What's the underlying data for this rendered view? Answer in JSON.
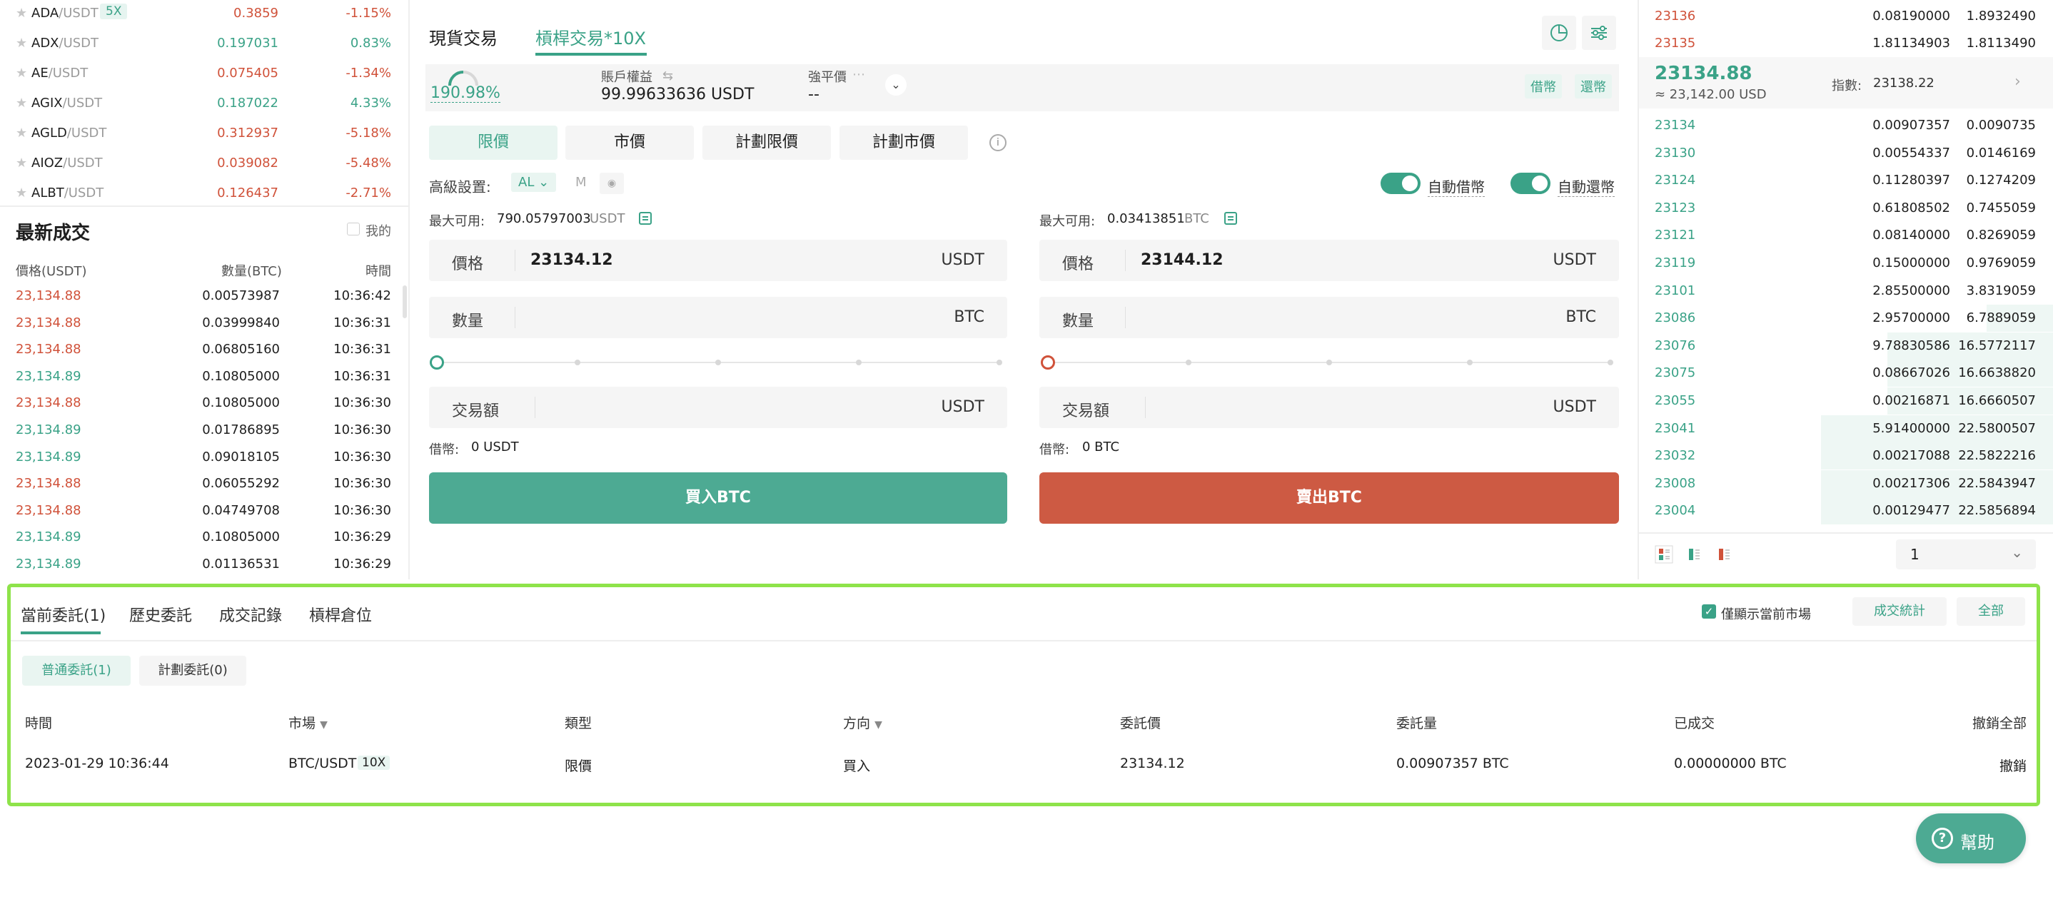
{
  "markets": [
    {
      "base": "ADA",
      "quote": "/USDT",
      "lev": "5X",
      "price": "0.3859",
      "change": "-1.15%",
      "dir": "down"
    },
    {
      "base": "ADX",
      "quote": "/USDT",
      "lev": "",
      "price": "0.197031",
      "change": "0.83%",
      "dir": "up"
    },
    {
      "base": "AE",
      "quote": "/USDT",
      "lev": "",
      "price": "0.075405",
      "change": "-1.34%",
      "dir": "down"
    },
    {
      "base": "AGIX",
      "quote": "/USDT",
      "lev": "",
      "price": "0.187022",
      "change": "4.33%",
      "dir": "up"
    },
    {
      "base": "AGLD",
      "quote": "/USDT",
      "lev": "",
      "price": "0.312937",
      "change": "-5.18%",
      "dir": "down"
    },
    {
      "base": "AIOZ",
      "quote": "/USDT",
      "lev": "",
      "price": "0.039082",
      "change": "-5.48%",
      "dir": "down"
    },
    {
      "base": "ALBT",
      "quote": "/USDT",
      "lev": "",
      "price": "0.126437",
      "change": "-2.71%",
      "dir": "down"
    }
  ],
  "latest_trades": {
    "title": "最新成交",
    "mine_label": "我的",
    "headers": {
      "price": "價格(USDT)",
      "qty": "數量(BTC)",
      "time": "時間"
    },
    "rows": [
      {
        "price": "23,134.88",
        "qty": "0.00573987",
        "time": "10:36:42",
        "dir": "down"
      },
      {
        "price": "23,134.88",
        "qty": "0.03999840",
        "time": "10:36:31",
        "dir": "down"
      },
      {
        "price": "23,134.88",
        "qty": "0.06805160",
        "time": "10:36:31",
        "dir": "down"
      },
      {
        "price": "23,134.89",
        "qty": "0.10805000",
        "time": "10:36:31",
        "dir": "up"
      },
      {
        "price": "23,134.88",
        "qty": "0.10805000",
        "time": "10:36:30",
        "dir": "down"
      },
      {
        "price": "23,134.89",
        "qty": "0.01786895",
        "time": "10:36:30",
        "dir": "up"
      },
      {
        "price": "23,134.89",
        "qty": "0.09018105",
        "time": "10:36:30",
        "dir": "up"
      },
      {
        "price": "23,134.88",
        "qty": "0.06055292",
        "time": "10:36:30",
        "dir": "down"
      },
      {
        "price": "23,134.88",
        "qty": "0.04749708",
        "time": "10:36:30",
        "dir": "down"
      },
      {
        "price": "23,134.89",
        "qty": "0.10805000",
        "time": "10:36:29",
        "dir": "up"
      },
      {
        "price": "23,134.89",
        "qty": "0.01136531",
        "time": "10:36:29",
        "dir": "up"
      }
    ]
  },
  "trade_tabs": {
    "spot": "現貨交易",
    "margin": "槓桿交易*10X"
  },
  "account": {
    "risk": "190.98%",
    "equity_label": "賬戶權益",
    "equity_value": "99.99633636 USDT",
    "liq_label": "強平價",
    "liq_value": "--",
    "borrow_btn": "借幣",
    "repay_btn": "還幣"
  },
  "order_types": [
    "限價",
    "市價",
    "計劃限價",
    "計劃市價"
  ],
  "advanced": {
    "label": "高級設置:",
    "al": "AL",
    "m": "M",
    "auto_borrow": "自動借幣",
    "auto_repay": "自動還幣"
  },
  "buy": {
    "avail_label": "最大可用:",
    "avail_value": "790.05797003",
    "avail_unit": "USDT",
    "price_label": "價格",
    "price_value": "23134.12",
    "price_unit": "USDT",
    "qty_label": "數量",
    "qty_unit": "BTC",
    "amt_label": "交易額",
    "amt_unit": "USDT",
    "borrow_label": "借幣:",
    "borrow_value": "0 USDT",
    "button": "買入BTC"
  },
  "sell": {
    "avail_label": "最大可用:",
    "avail_value": "0.03413851",
    "avail_unit": "BTC",
    "price_label": "價格",
    "price_value": "23144.12",
    "price_unit": "USDT",
    "qty_label": "數量",
    "qty_unit": "BTC",
    "amt_label": "交易額",
    "amt_unit": "USDT",
    "borrow_label": "借幣:",
    "borrow_value": "0 BTC",
    "button": "賣出BTC"
  },
  "orderbook": {
    "asks": [
      {
        "price": "23136",
        "qty": "0.08190000",
        "sum": "1.8932490"
      },
      {
        "price": "23135",
        "qty": "1.81134903",
        "sum": "1.8113490"
      }
    ],
    "last_price": "23134.88",
    "last_usd": "≈ 23,142.00 USD",
    "index_label": "指數:",
    "index_value": "23138.22",
    "bids": [
      {
        "price": "23134",
        "qty": "0.00907357",
        "sum": "0.0090735",
        "depth": 0.0
      },
      {
        "price": "23130",
        "qty": "0.00554337",
        "sum": "0.0146169",
        "depth": 0.0
      },
      {
        "price": "23124",
        "qty": "0.11280397",
        "sum": "0.1274209",
        "depth": 0.0
      },
      {
        "price": "23123",
        "qty": "0.61808502",
        "sum": "0.7455059",
        "depth": 0.0
      },
      {
        "price": "23121",
        "qty": "0.08140000",
        "sum": "0.8269059",
        "depth": 0.0
      },
      {
        "price": "23119",
        "qty": "0.15000000",
        "sum": "0.9769059",
        "depth": 0.0
      },
      {
        "price": "23101",
        "qty": "2.85500000",
        "sum": "3.8319059",
        "depth": 0.0
      },
      {
        "price": "23086",
        "qty": "2.95700000",
        "sum": "6.7889059",
        "depth": 0.16
      },
      {
        "price": "23076",
        "qty": "9.78830586",
        "sum": "16.5772117",
        "depth": 0.4
      },
      {
        "price": "23075",
        "qty": "0.08667026",
        "sum": "16.6638820",
        "depth": 0.4
      },
      {
        "price": "23055",
        "qty": "0.00216871",
        "sum": "16.6660507",
        "depth": 0.4
      },
      {
        "price": "23041",
        "qty": "5.91400000",
        "sum": "22.5800507",
        "depth": 0.56
      },
      {
        "price": "23032",
        "qty": "0.00217088",
        "sum": "22.5822216",
        "depth": 0.56
      },
      {
        "price": "23008",
        "qty": "0.00217306",
        "sum": "22.5843947",
        "depth": 0.56
      },
      {
        "price": "23004",
        "qty": "0.00129477",
        "sum": "22.5856894",
        "depth": 0.56
      }
    ],
    "precision": "1"
  },
  "orders": {
    "tabs": [
      "當前委託(1)",
      "歷史委託",
      "成交記錄",
      "槓桿倉位"
    ],
    "only_current_label": "僅顯示當前市場",
    "stats_btn": "成交統計",
    "all_btn": "全部",
    "subtabs": [
      "普通委託(1)",
      "計劃委託(0)"
    ],
    "headers": {
      "time": "時間",
      "market": "市場",
      "type": "類型",
      "side": "方向",
      "price": "委託價",
      "amount": "委託量",
      "filled": "已成交",
      "cancel_all": "撤銷全部"
    },
    "rows": [
      {
        "time": "2023-01-29 10:36:44",
        "market": "BTC/USDT",
        "lev": "10X",
        "type": "限價",
        "side": "買入",
        "price": "23134.12",
        "amount": "0.00907357 BTC",
        "filled": "0.00000000 BTC",
        "cancel": "撤銷"
      }
    ]
  },
  "help_btn": "幫助",
  "colors": {
    "green": "#3aa287",
    "red": "#d0523a",
    "highlight": "#8ee34a"
  }
}
